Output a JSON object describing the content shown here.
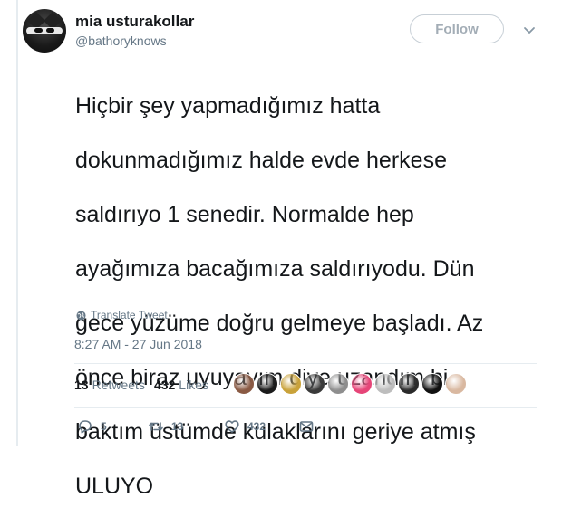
{
  "author": {
    "display_name": "mia usturakollar",
    "username": "@bathoryknows",
    "avatar_icon": "cat-mask-avatar"
  },
  "header": {
    "follow_label": "Follow",
    "menu_icon": "chevron-down-icon"
  },
  "tweet": {
    "lines": [
      "Hiçbir şey yapmadığımız hatta",
      "dokunmadığımız halde evde herkese",
      "saldırıyo 1 senedir. Normalde hep",
      "ayağımıza bacağımıza saldırıyodu. Dün",
      "gece yüzüme doğru gelmeye başladı. Az",
      "önce biraz uyuyayım diye uzandım bi",
      "baktım üstümde kulaklarını geriye atmış",
      "ULUYO"
    ],
    "translate_label": "Translate Tweet",
    "timestamp": "8:27 AM - 27 Jun 2018"
  },
  "stats": {
    "retweets_count": "13",
    "retweets_label": "Retweets",
    "likes_count": "432",
    "likes_label": "Likes",
    "liker_colors": [
      "#8a5a44",
      "#1b1b1b",
      "#c9a23a",
      "#3a3a3a",
      "#8e8e8e",
      "#e64578",
      "#bdbdbd",
      "#2a2a2a",
      "#111111",
      "#d9b8a0"
    ]
  },
  "actions": {
    "reply_count": "5",
    "retweet_count": "13",
    "like_count": "432"
  },
  "colors": {
    "text": "#14171a",
    "muted": "#657786",
    "divider": "#e6ecf0"
  }
}
